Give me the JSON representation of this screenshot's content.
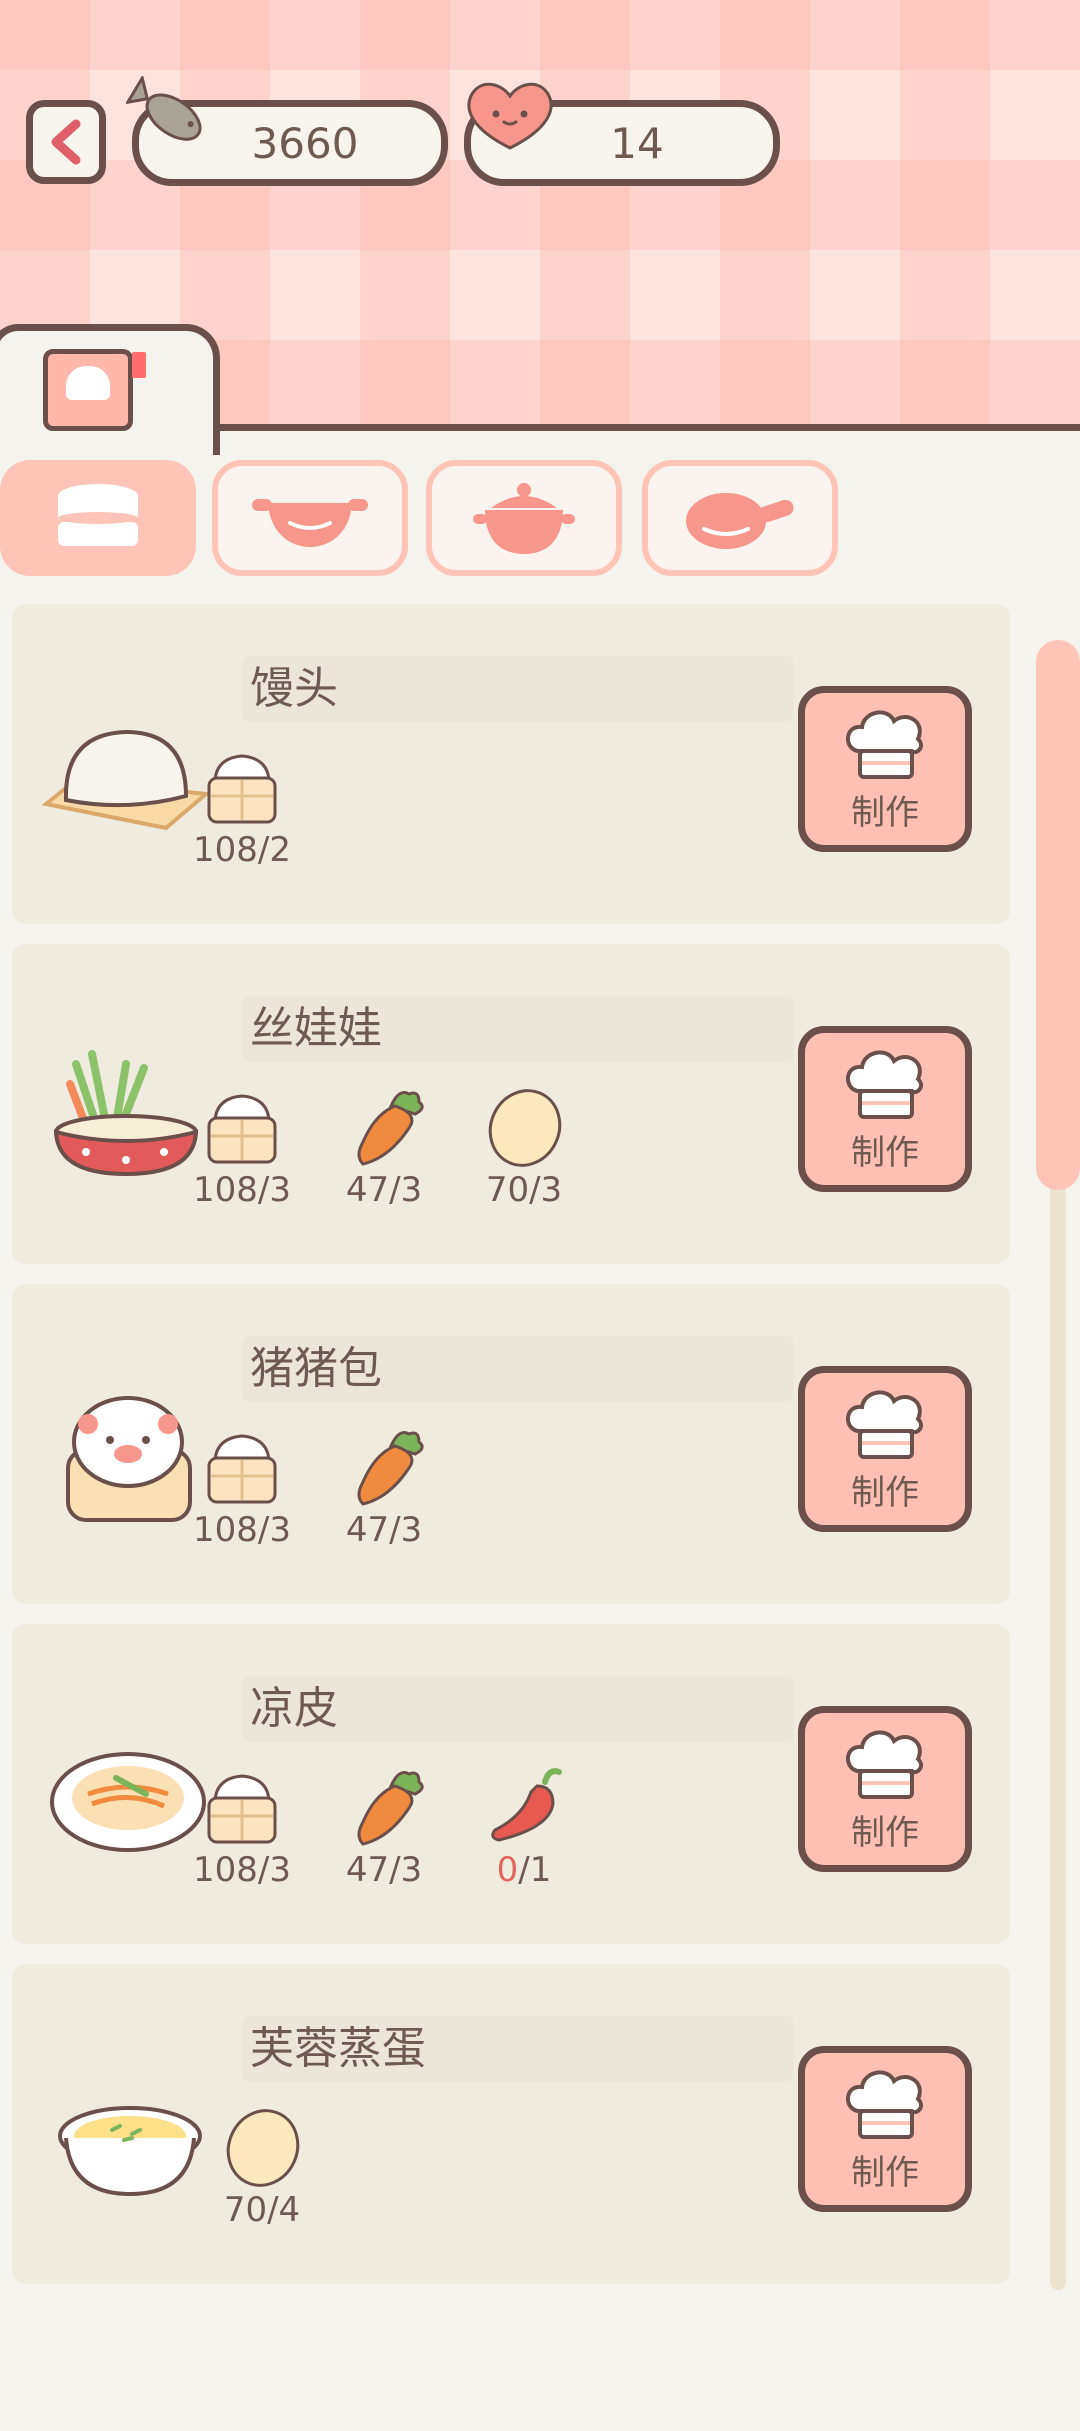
{
  "currency": {
    "fish": "3660",
    "hearts": "14"
  },
  "make_label": "制作",
  "categories": [
    {
      "icon": "steamer-icon",
      "active": true
    },
    {
      "icon": "wok-icon",
      "active": false
    },
    {
      "icon": "pot-icon",
      "active": false
    },
    {
      "icon": "pan-icon",
      "active": false
    }
  ],
  "recipes": [
    {
      "name": "馒头",
      "dish_icon": "mantou-icon",
      "ingredients": [
        {
          "icon": "flour-icon",
          "have": "108",
          "need": "2"
        }
      ]
    },
    {
      "name": "丝娃娃",
      "dish_icon": "siwawa-icon",
      "ingredients": [
        {
          "icon": "flour-icon",
          "have": "108",
          "need": "3"
        },
        {
          "icon": "carrot-icon",
          "have": "47",
          "need": "3"
        },
        {
          "icon": "egg-icon",
          "have": "70",
          "need": "3"
        }
      ]
    },
    {
      "name": "猪猪包",
      "dish_icon": "pig-bun-icon",
      "ingredients": [
        {
          "icon": "flour-icon",
          "have": "108",
          "need": "3"
        },
        {
          "icon": "carrot-icon",
          "have": "47",
          "need": "3"
        }
      ]
    },
    {
      "name": "凉皮",
      "dish_icon": "liangpi-icon",
      "ingredients": [
        {
          "icon": "flour-icon",
          "have": "108",
          "need": "3"
        },
        {
          "icon": "carrot-icon",
          "have": "47",
          "need": "3"
        },
        {
          "icon": "chili-icon",
          "have": "0",
          "need": "1",
          "lacking": true
        }
      ]
    },
    {
      "name": "芙蓉蒸蛋",
      "dish_icon": "steamed-egg-icon",
      "ingredients": [
        {
          "icon": "egg-icon",
          "have": "70",
          "need": "4"
        }
      ]
    }
  ],
  "colors": {
    "accent": "#ffc4b8",
    "outline": "#6b4f4a",
    "lacking": "#e0685e"
  }
}
